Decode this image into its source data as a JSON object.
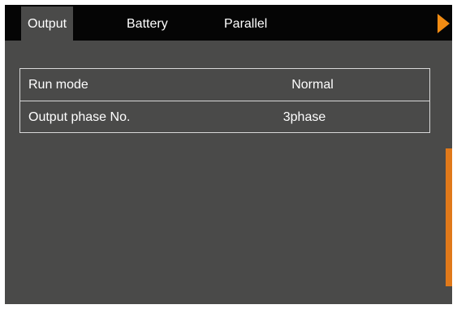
{
  "tabs": [
    {
      "label": "Output",
      "active": true
    },
    {
      "label": "Battery",
      "active": false
    },
    {
      "label": "Parallel",
      "active": false
    }
  ],
  "settings": [
    {
      "label": "Run mode",
      "value": "Normal"
    },
    {
      "label": "Output phase No.",
      "value": "3phase"
    }
  ],
  "colors": {
    "background": "#4a4a49",
    "tabbar": "#050505",
    "accent": "#f28c13",
    "scrollbar": "#e0791a",
    "text": "#ffffff",
    "border": "#d8d8d8"
  },
  "icons": {
    "next": "triangle-right-icon"
  }
}
